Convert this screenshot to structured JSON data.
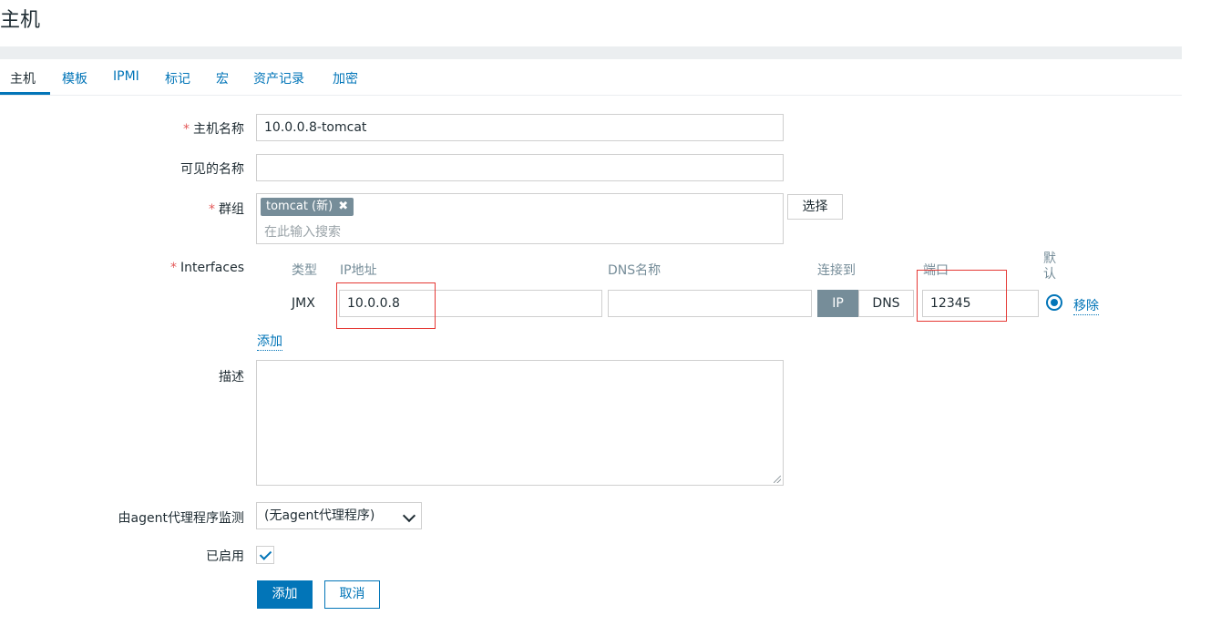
{
  "page": {
    "title": "主机"
  },
  "tabs": [
    {
      "label": "主机"
    },
    {
      "label": "模板"
    },
    {
      "label": "IPMI"
    },
    {
      "label": "标记"
    },
    {
      "label": "宏"
    },
    {
      "label": "资产记录"
    },
    {
      "label": "加密"
    }
  ],
  "form": {
    "host_name": {
      "label": "主机名称",
      "required_mark": "*",
      "value": "10.0.0.8-tomcat"
    },
    "visible_name": {
      "label": "可见的名称",
      "value": ""
    },
    "groups": {
      "label": "群组",
      "required_mark": "*",
      "chip": "tomcat (新)",
      "chip_remove": "✖",
      "placeholder": "在此输入搜索",
      "select_button": "选择"
    },
    "interfaces": {
      "label": "Interfaces",
      "required_mark": "*",
      "headers": {
        "type": "类型",
        "ip": "IP地址",
        "dns": "DNS名称",
        "connect": "连接到",
        "port": "端口",
        "default": "默认"
      },
      "row": {
        "type": "JMX",
        "ip": "10.0.0.8",
        "dns": "",
        "connect_ip": "IP",
        "connect_dns": "DNS",
        "port": "12345",
        "remove": "移除"
      },
      "add_link": "添加"
    },
    "description": {
      "label": "描述",
      "value": ""
    },
    "proxy": {
      "label": "由agent代理程序监测",
      "selected": "(无agent代理程序)"
    },
    "enabled": {
      "label": "已启用",
      "checked": true
    },
    "buttons": {
      "add": "添加",
      "cancel": "取消"
    }
  },
  "colors": {
    "accent": "#0275b8",
    "required": "#e45959",
    "highlight_box": "#e53935"
  }
}
